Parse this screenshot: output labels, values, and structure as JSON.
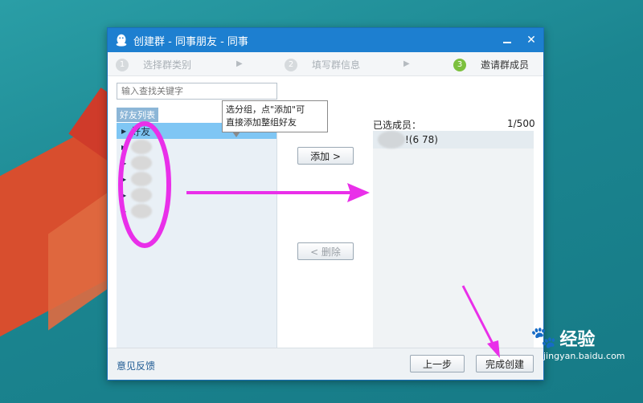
{
  "window": {
    "title": "创建群 - 同事朋友 - 同事",
    "min_label": "",
    "close_label": "✕"
  },
  "steps": [
    {
      "num": "1",
      "label": "选择群类别"
    },
    {
      "num": "2",
      "label": "填写群信息"
    },
    {
      "num": "3",
      "label": "邀请群成员"
    }
  ],
  "search": {
    "placeholder": "输入查找关键字"
  },
  "friends_tab": "好友列表",
  "friend_list": {
    "group_label": "好友"
  },
  "tooltip": {
    "line1": "选分组，点\"添加\"可",
    "line2": "直接添加整组好友"
  },
  "buttons": {
    "add": "添加 >",
    "remove": "< 删除",
    "prev": "上一步",
    "finish": "完成创建"
  },
  "selected": {
    "title": "已选成员：",
    "count": "1/500",
    "member_text": "!(6        78)"
  },
  "footer": {
    "feedback": "意见反馈"
  },
  "watermark": {
    "brand": "经验",
    "url": "jingyan.baidu.com"
  },
  "colors": {
    "titlebar": "#1d7fd0",
    "annotation": "#e92fe9",
    "active_step": "#7cc03e"
  }
}
